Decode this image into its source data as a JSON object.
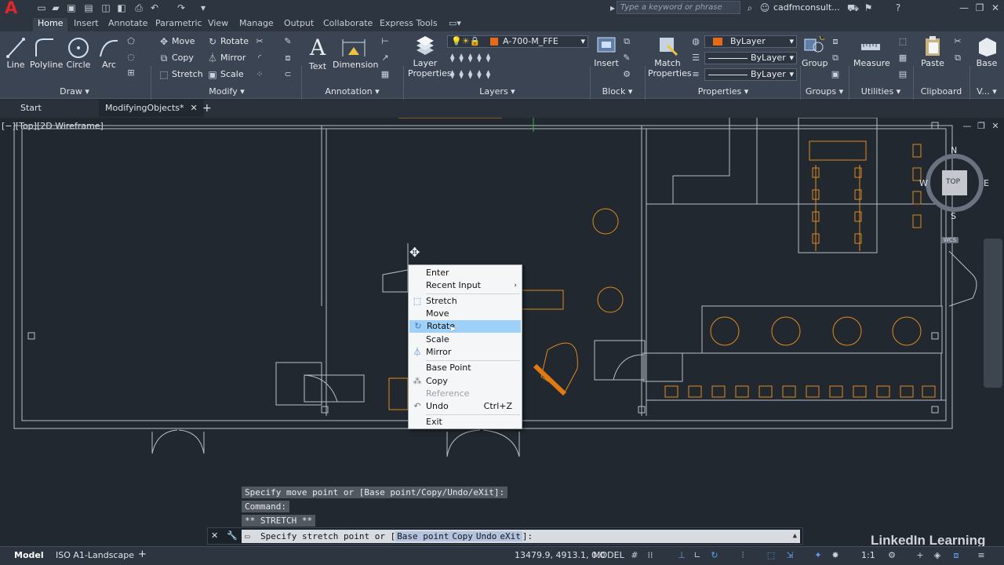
{
  "app": {
    "logo": "A",
    "search_placeholder": "Type a keyword or phrase",
    "user": "cadfmconsult..."
  },
  "ribbon_tabs": [
    "Home",
    "Insert",
    "Annotate",
    "Parametric",
    "View",
    "Manage",
    "Output",
    "Collaborate",
    "Express Tools"
  ],
  "draw": {
    "line": "Line",
    "polyline": "Polyline",
    "circle": "Circle",
    "arc": "Arc",
    "title": "Draw"
  },
  "modify": {
    "move": "Move",
    "rotate": "Rotate",
    "copy": "Copy",
    "mirror": "Mirror",
    "stretch": "Stretch",
    "scale": "Scale",
    "title": "Modify"
  },
  "annotation": {
    "text": "Text",
    "dimension": "Dimension",
    "title": "Annotation"
  },
  "layers": {
    "layer_properties_1": "Layer",
    "layer_properties_2": "Properties",
    "current_layer": "A-700-M_FFE",
    "title": "Layers"
  },
  "block": {
    "insert": "Insert",
    "title": "Block"
  },
  "properties": {
    "match_1": "Match",
    "match_2": "Properties",
    "color": "ByLayer",
    "linetype": "ByLayer",
    "lineweight": "ByLayer",
    "title": "Properties"
  },
  "groups": {
    "group": "Group",
    "title": "Groups"
  },
  "utilities": {
    "measure": "Measure",
    "title": "Utilities"
  },
  "clipboard": {
    "paste": "Paste",
    "title": "Clipboard"
  },
  "view_panel": {
    "base": "Base",
    "title": "V..."
  },
  "doc_tabs": [
    "Start",
    "ModifyingObjects*"
  ],
  "viewport_label": "[−][Top][2D Wireframe]",
  "viewcube": {
    "n": "N",
    "s": "S",
    "e": "E",
    "w": "W",
    "top": "TOP",
    "wcs": "WCS"
  },
  "context_menu": {
    "enter": "Enter",
    "recent_input": "Recent Input",
    "stretch": "Stretch",
    "move": "Move",
    "rotate": "Rotate",
    "scale": "Scale",
    "mirror": "Mirror",
    "base_point": "Base Point",
    "copy": "Copy",
    "reference": "Reference",
    "undo": "Undo",
    "undo_shortcut": "Ctrl+Z",
    "exit": "Exit"
  },
  "command_history": [
    "Specify move point or [Base point/Copy/Undo/eXit]:",
    "Command:",
    "** STRETCH **"
  ],
  "command_prompt": {
    "prefix": "Specify stretch point or [",
    "base_point": "Base point",
    "copy": "Copy",
    "undo": "Undo",
    "exit": "eXit",
    "suffix": "]:"
  },
  "status_bar": {
    "model_tab": "Model",
    "layout_tab": "ISO A1-Landscape",
    "coords": "13479.9, 4913.1, 0.0",
    "mode": "MODEL",
    "scale": "1:1"
  },
  "watermark": "LinkedIn Learning",
  "colors": {
    "accent_blue": "#3a7ac8",
    "menu_highlight": "#9fd0f7",
    "furniture_orange": "#e08a1e",
    "wall_gray": "#b9bec4"
  }
}
